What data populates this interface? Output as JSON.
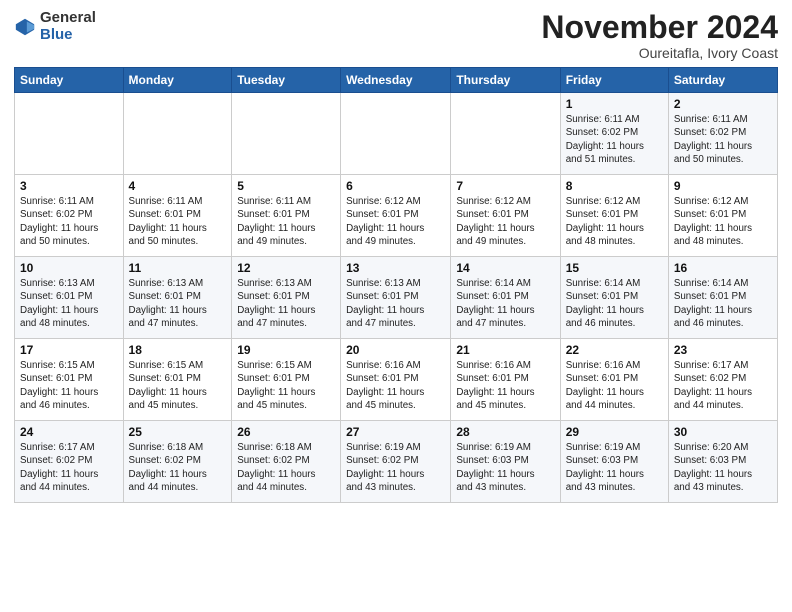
{
  "header": {
    "logo_general": "General",
    "logo_blue": "Blue",
    "month_title": "November 2024",
    "location": "Oureitafla, Ivory Coast"
  },
  "weekdays": [
    "Sunday",
    "Monday",
    "Tuesday",
    "Wednesday",
    "Thursday",
    "Friday",
    "Saturday"
  ],
  "weeks": [
    [
      {
        "day": "",
        "info": ""
      },
      {
        "day": "",
        "info": ""
      },
      {
        "day": "",
        "info": ""
      },
      {
        "day": "",
        "info": ""
      },
      {
        "day": "",
        "info": ""
      },
      {
        "day": "1",
        "info": "Sunrise: 6:11 AM\nSunset: 6:02 PM\nDaylight: 11 hours\nand 51 minutes."
      },
      {
        "day": "2",
        "info": "Sunrise: 6:11 AM\nSunset: 6:02 PM\nDaylight: 11 hours\nand 50 minutes."
      }
    ],
    [
      {
        "day": "3",
        "info": "Sunrise: 6:11 AM\nSunset: 6:02 PM\nDaylight: 11 hours\nand 50 minutes."
      },
      {
        "day": "4",
        "info": "Sunrise: 6:11 AM\nSunset: 6:01 PM\nDaylight: 11 hours\nand 50 minutes."
      },
      {
        "day": "5",
        "info": "Sunrise: 6:11 AM\nSunset: 6:01 PM\nDaylight: 11 hours\nand 49 minutes."
      },
      {
        "day": "6",
        "info": "Sunrise: 6:12 AM\nSunset: 6:01 PM\nDaylight: 11 hours\nand 49 minutes."
      },
      {
        "day": "7",
        "info": "Sunrise: 6:12 AM\nSunset: 6:01 PM\nDaylight: 11 hours\nand 49 minutes."
      },
      {
        "day": "8",
        "info": "Sunrise: 6:12 AM\nSunset: 6:01 PM\nDaylight: 11 hours\nand 48 minutes."
      },
      {
        "day": "9",
        "info": "Sunrise: 6:12 AM\nSunset: 6:01 PM\nDaylight: 11 hours\nand 48 minutes."
      }
    ],
    [
      {
        "day": "10",
        "info": "Sunrise: 6:13 AM\nSunset: 6:01 PM\nDaylight: 11 hours\nand 48 minutes."
      },
      {
        "day": "11",
        "info": "Sunrise: 6:13 AM\nSunset: 6:01 PM\nDaylight: 11 hours\nand 47 minutes."
      },
      {
        "day": "12",
        "info": "Sunrise: 6:13 AM\nSunset: 6:01 PM\nDaylight: 11 hours\nand 47 minutes."
      },
      {
        "day": "13",
        "info": "Sunrise: 6:13 AM\nSunset: 6:01 PM\nDaylight: 11 hours\nand 47 minutes."
      },
      {
        "day": "14",
        "info": "Sunrise: 6:14 AM\nSunset: 6:01 PM\nDaylight: 11 hours\nand 47 minutes."
      },
      {
        "day": "15",
        "info": "Sunrise: 6:14 AM\nSunset: 6:01 PM\nDaylight: 11 hours\nand 46 minutes."
      },
      {
        "day": "16",
        "info": "Sunrise: 6:14 AM\nSunset: 6:01 PM\nDaylight: 11 hours\nand 46 minutes."
      }
    ],
    [
      {
        "day": "17",
        "info": "Sunrise: 6:15 AM\nSunset: 6:01 PM\nDaylight: 11 hours\nand 46 minutes."
      },
      {
        "day": "18",
        "info": "Sunrise: 6:15 AM\nSunset: 6:01 PM\nDaylight: 11 hours\nand 45 minutes."
      },
      {
        "day": "19",
        "info": "Sunrise: 6:15 AM\nSunset: 6:01 PM\nDaylight: 11 hours\nand 45 minutes."
      },
      {
        "day": "20",
        "info": "Sunrise: 6:16 AM\nSunset: 6:01 PM\nDaylight: 11 hours\nand 45 minutes."
      },
      {
        "day": "21",
        "info": "Sunrise: 6:16 AM\nSunset: 6:01 PM\nDaylight: 11 hours\nand 45 minutes."
      },
      {
        "day": "22",
        "info": "Sunrise: 6:16 AM\nSunset: 6:01 PM\nDaylight: 11 hours\nand 44 minutes."
      },
      {
        "day": "23",
        "info": "Sunrise: 6:17 AM\nSunset: 6:02 PM\nDaylight: 11 hours\nand 44 minutes."
      }
    ],
    [
      {
        "day": "24",
        "info": "Sunrise: 6:17 AM\nSunset: 6:02 PM\nDaylight: 11 hours\nand 44 minutes."
      },
      {
        "day": "25",
        "info": "Sunrise: 6:18 AM\nSunset: 6:02 PM\nDaylight: 11 hours\nand 44 minutes."
      },
      {
        "day": "26",
        "info": "Sunrise: 6:18 AM\nSunset: 6:02 PM\nDaylight: 11 hours\nand 44 minutes."
      },
      {
        "day": "27",
        "info": "Sunrise: 6:19 AM\nSunset: 6:02 PM\nDaylight: 11 hours\nand 43 minutes."
      },
      {
        "day": "28",
        "info": "Sunrise: 6:19 AM\nSunset: 6:03 PM\nDaylight: 11 hours\nand 43 minutes."
      },
      {
        "day": "29",
        "info": "Sunrise: 6:19 AM\nSunset: 6:03 PM\nDaylight: 11 hours\nand 43 minutes."
      },
      {
        "day": "30",
        "info": "Sunrise: 6:20 AM\nSunset: 6:03 PM\nDaylight: 11 hours\nand 43 minutes."
      }
    ]
  ]
}
